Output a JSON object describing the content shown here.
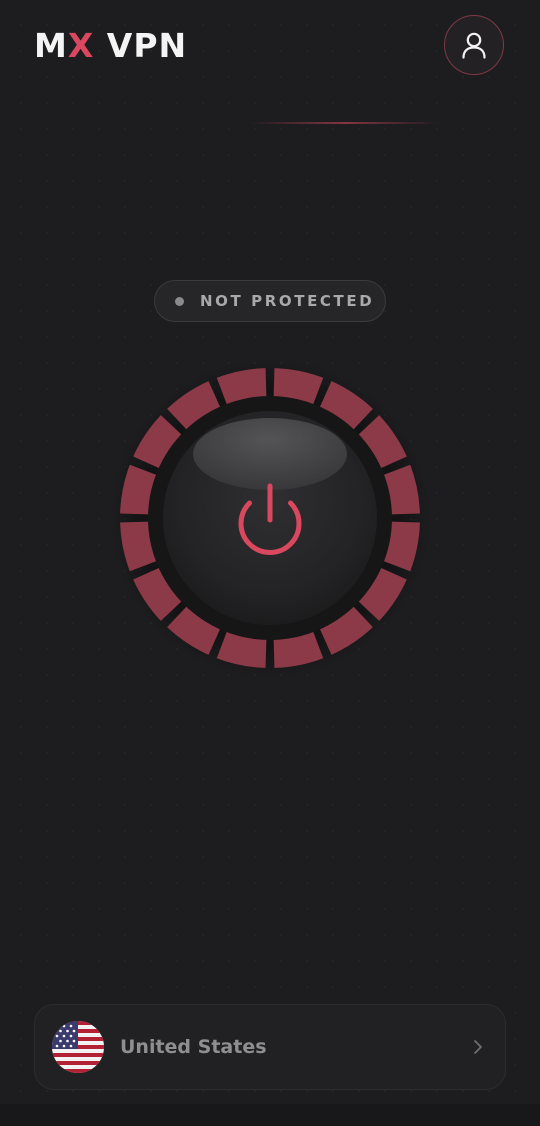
{
  "header": {
    "logo_part1": "M",
    "logo_accent": "X",
    "logo_part2": " VPN",
    "profile_icon": "user-icon"
  },
  "status": {
    "label": "NOT PROTECTED",
    "dot_color": "#8a8a8a"
  },
  "power": {
    "icon": "power-icon",
    "accent_color": "#d9485f",
    "ring_segments": 16,
    "connected": false
  },
  "location": {
    "country": "United States",
    "flag_icon": "us-flag-icon",
    "chevron_icon": "chevron-right-icon"
  },
  "colors": {
    "background": "#1d1d1f",
    "accent": "#d9485f",
    "ring": "#8c3a47"
  }
}
